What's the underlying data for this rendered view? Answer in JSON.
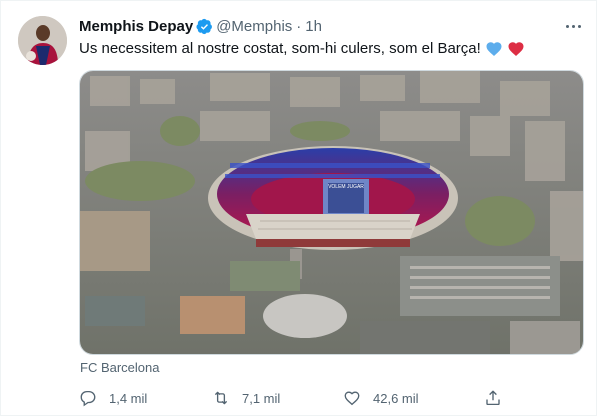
{
  "tweet": {
    "author_name": "Memphis Depay",
    "handle": "@Memphis",
    "separator": "·",
    "time": "1h",
    "text": "Us necessitem al nostre costat, som-hi culers, som el Barça!",
    "media_source": "FC Barcelona",
    "stadium_banner": "VOLEM JUGAR"
  },
  "actions": {
    "replies": "1,4 mil",
    "retweets": "7,1 mil",
    "likes": "42,6 mil"
  },
  "colors": {
    "verified": "#1d9bf0",
    "blue_heart": "#5dadec",
    "red_heart": "#dd2e44",
    "muted_text": "#536471"
  },
  "icons": [
    "verified-badge-icon",
    "more-icon",
    "blue-heart-emoji",
    "red-heart-emoji",
    "reply-icon",
    "retweet-icon",
    "like-icon",
    "share-icon"
  ]
}
